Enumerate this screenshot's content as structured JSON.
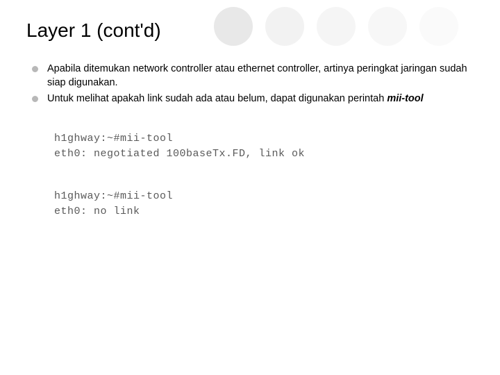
{
  "title": "Layer 1 (cont'd)",
  "bullets": [
    {
      "text_a": "Apabila ditemukan network controller atau ethernet controller, artinya peringkat jaringan sudah siap digunakan."
    },
    {
      "text_a": "Untuk melihat apakah link sudah ada atau belum, dapat digunakan perintah ",
      "tool": "mii-tool"
    }
  ],
  "terminal1": "h1ghway:~#mii-tool\neth0: negotiated 100baseTx.FD, link ok",
  "terminal2": "h1ghway:~#mii-tool\neth0: no link"
}
